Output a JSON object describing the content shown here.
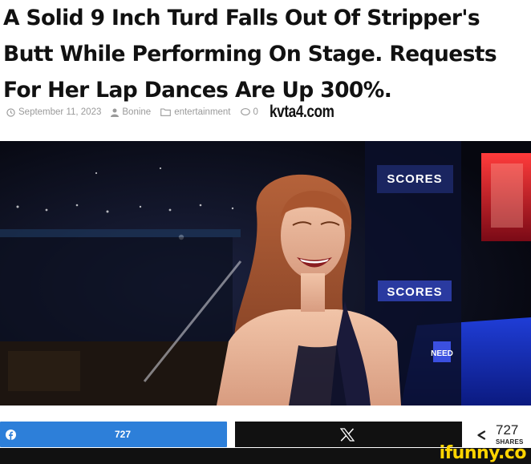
{
  "article": {
    "headline": "A Solid 9 Inch Turd Falls Out Of Stripper's Butt While Performing On Stage. Requests For Her Lap Dances Are Up 300%.",
    "date": "September 11, 2023",
    "author": "Bonine",
    "category": "entertainment",
    "comments": "0",
    "site": "kvta4.com"
  },
  "video": {
    "signs": [
      "SCORES",
      "SCORES",
      "NEED"
    ]
  },
  "share": {
    "facebook_count": "727",
    "total_count": "727",
    "total_label": "SHARES"
  },
  "watermark": "ifunny.co",
  "colors": {
    "facebook": "#2d7fd9",
    "x": "#111111",
    "watermark": "#ffd400"
  }
}
